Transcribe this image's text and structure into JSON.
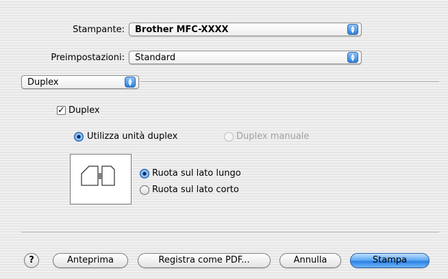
{
  "printer": {
    "label": "Stampante:",
    "value": "Brother MFC-XXXX"
  },
  "presets": {
    "label": "Preimpostazioni:",
    "value": "Standard"
  },
  "section_menu": {
    "value": "Duplex"
  },
  "duplex": {
    "checkbox_label": "Duplex",
    "checked": true,
    "mode_options": [
      {
        "label": "Utilizza unità duplex",
        "selected": true,
        "enabled": true
      },
      {
        "label": "Duplex manuale",
        "selected": false,
        "enabled": false
      }
    ],
    "binding_options": [
      {
        "label": "Ruota sul lato lungo",
        "selected": true
      },
      {
        "label": "Ruota sul lato corto",
        "selected": false
      }
    ]
  },
  "buttons": {
    "help": "?",
    "preview": "Anteprima",
    "save_pdf": "Registra come PDF...",
    "cancel": "Annulla",
    "print": "Stampa"
  },
  "colors": {
    "accent": "#3e8de6",
    "default_button": "#5aa6f0"
  }
}
